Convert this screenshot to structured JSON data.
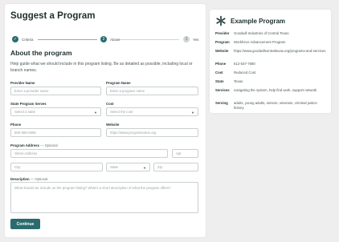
{
  "form": {
    "title": "Suggest a Program",
    "steps": [
      {
        "label": "Criteria",
        "state": "done",
        "marker": "✓"
      },
      {
        "label": "About",
        "state": "current",
        "marker": "2"
      },
      {
        "label": "Yes",
        "state": "todo",
        "marker": "3"
      }
    ],
    "section_title": "About the program",
    "help_text": "Help guide what we should include in this program listing. Be as detailed as possible, including local or branch names.",
    "provider_name": {
      "label": "Provider Name",
      "placeholder": "Enter a provider name"
    },
    "program_name": {
      "label": "Program Name",
      "placeholder": "Enter a program name"
    },
    "state_served": {
      "label": "State Program Serves",
      "placeholder": "Select a state"
    },
    "cost": {
      "label": "Cost",
      "placeholder": "Select the cost"
    },
    "phone": {
      "label": "Phone",
      "placeholder": "555-555-5555"
    },
    "website": {
      "label": "Website",
      "placeholder": "https://www.programname.org"
    },
    "address": {
      "label": "Program Address",
      "optional": "— Optional",
      "street_placeholder": "Street Address",
      "apt_placeholder": "Apt",
      "city_placeholder": "City",
      "state_placeholder": "State",
      "zip_placeholder": "Zip"
    },
    "description": {
      "label": "Description",
      "optional": "— Optional",
      "placeholder": "What should we include on the program listing? What's a short description of what the program offers?"
    },
    "continue_label": "Continue"
  },
  "example": {
    "title": "Example Program",
    "icon": "asterisk-logo-icon",
    "rows": [
      {
        "key": "Provider",
        "value": "Goodwill Industries of Central Texas"
      },
      {
        "key": "Program",
        "value": "Workforce Advancement Program"
      },
      {
        "key": "Website",
        "value": "https://www.goodwillcentraltexas.org/programs-and-services"
      },
      {
        "key": "Phone",
        "value": "512-637-7580"
      },
      {
        "key": "Cost",
        "value": "Reduced Cost"
      },
      {
        "key": "State",
        "value": "Texas"
      },
      {
        "key": "Services",
        "value": "navigating the system, help find work, support network"
      },
      {
        "key": "Serving",
        "value": "adults, young adults, seniors, veterans, criminal justice history"
      }
    ]
  },
  "colors": {
    "accent": "#2b6b6e",
    "background": "#eeeeee"
  }
}
